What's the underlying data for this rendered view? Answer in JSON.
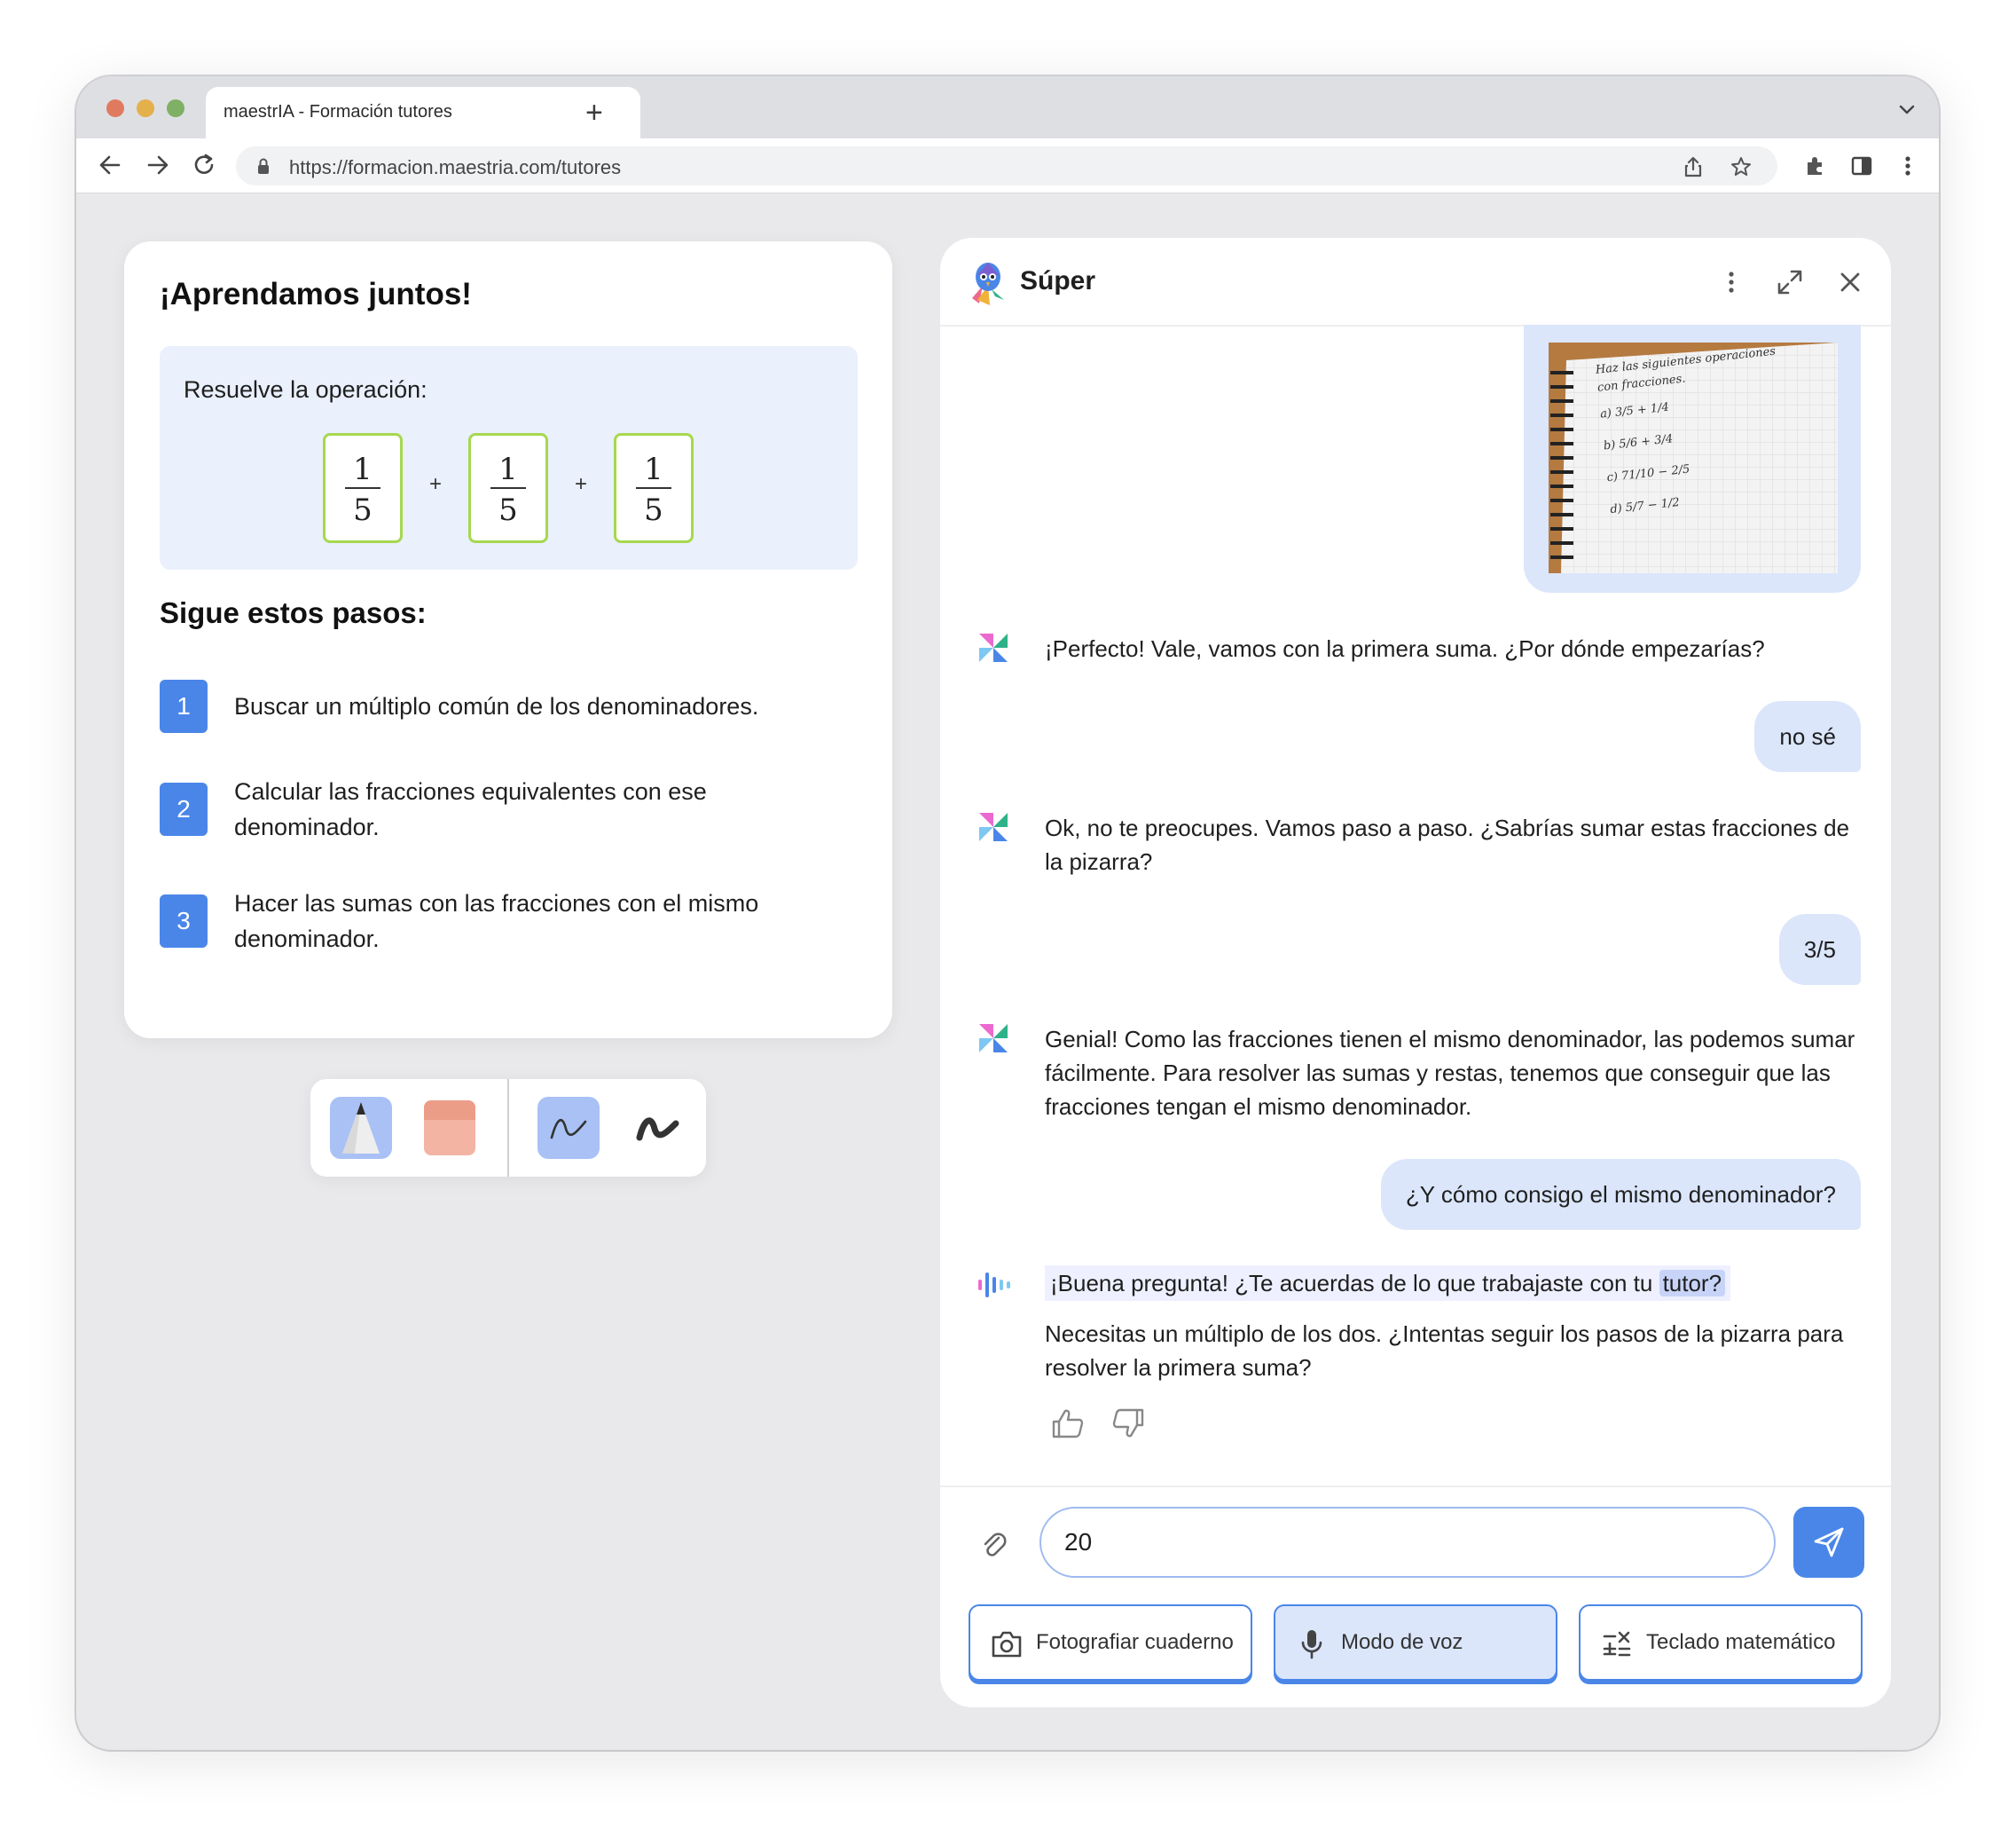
{
  "browser": {
    "tab_title": "maestrIA - Formación tutores",
    "new_tab": "+",
    "url": "https://formacion.maestria.com/tutores"
  },
  "lesson": {
    "title": "¡Aprendamos juntos!",
    "operation_label": "Resuelve la operación:",
    "fractions": [
      {
        "num": "1",
        "den": "5"
      },
      {
        "num": "1",
        "den": "5"
      },
      {
        "num": "1",
        "den": "5"
      }
    ],
    "operator": "+",
    "steps_title": "Sigue estos pasos:",
    "steps": [
      {
        "number": "1",
        "text": "Buscar un múltiplo común de los denominadores."
      },
      {
        "number": "2",
        "text": "Calcular las fracciones equivalentes con ese denominador."
      },
      {
        "number": "3",
        "text": "Hacer las sumas con las fracciones con el mismo denominador."
      }
    ]
  },
  "tools": {
    "items": [
      "pencil-icon",
      "eraser-icon",
      "thin-stroke-icon",
      "thick-stroke-icon"
    ],
    "active_tool": "pencil-icon",
    "active_stroke": "thin-stroke-icon"
  },
  "chat": {
    "title": "Súper",
    "photo_text": {
      "heading": "Haz las siguientes operaciones con fracciones.",
      "items": [
        "a) 3/5 + 1/4",
        "b) 5/6 + 3/4",
        "c) 71/10 − 2/5",
        "d) 5/7 − 1/2"
      ]
    },
    "messages": [
      {
        "role": "bot",
        "text": "¡Perfecto! Vale, vamos con la primera suma. ¿Por dónde empezarías?"
      },
      {
        "role": "user",
        "text": "no sé"
      },
      {
        "role": "bot",
        "text": "Ok, no te preocupes. Vamos paso a paso. ¿Sabrías sumar estas fracciones de la pizarra?"
      },
      {
        "role": "user",
        "text": "3/5"
      },
      {
        "role": "bot",
        "text": "Genial! Como las fracciones tienen el mismo denominador, las podemos sumar fácilmente. Para resolver las sumas y restas, tenemos que conseguir que las fracciones tengan el mismo denominador."
      },
      {
        "role": "user",
        "text": "¿Y cómo consigo el mismo denominador?"
      }
    ],
    "speaking": {
      "line_before": "¡Buena pregunta! ¿Te acuerdas de lo que trabajaste con tu ",
      "line_highlight": "tutor?",
      "rest": "Necesitas un múltiplo de los dos. ¿Intentas seguir los pasos de la pizarra para resolver la primera suma?"
    },
    "input_value": "20",
    "actions": [
      {
        "label": "Fotografiar cuaderno",
        "icon": "camera-icon"
      },
      {
        "label": "Modo de voz",
        "icon": "microphone-icon"
      },
      {
        "label": "Teclado matemático",
        "icon": "math-keyboard-icon"
      }
    ],
    "accent_color": "#4a86e8",
    "bubble_color": "#dbe6fb"
  }
}
